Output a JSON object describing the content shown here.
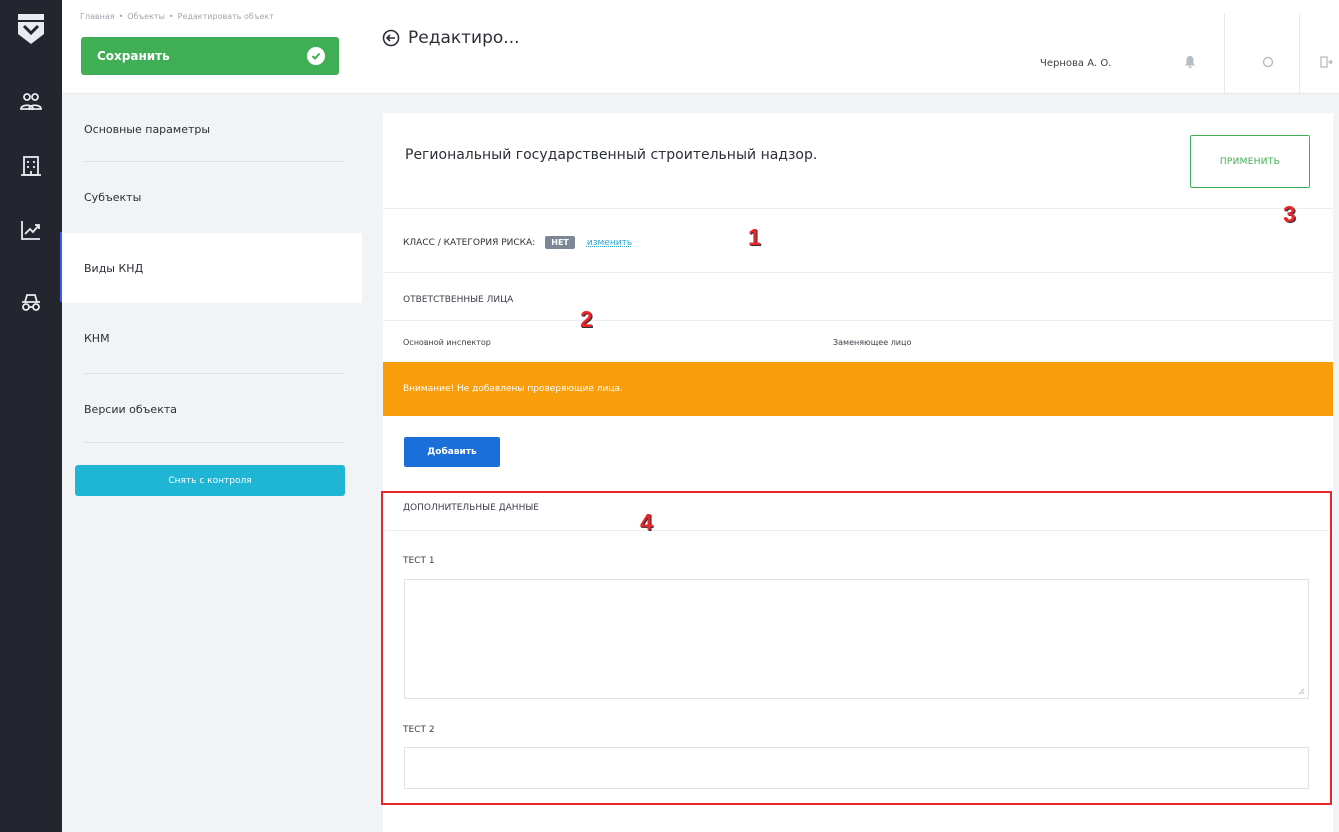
{
  "breadcrumb": {
    "items": [
      "Главная",
      "Объекты",
      "Редактировать объект"
    ]
  },
  "header": {
    "save_label": "Сохранить",
    "title": "Редактиро...",
    "user_name": "Чернова А. О."
  },
  "side_menu": {
    "items": [
      {
        "label": "Основные параметры"
      },
      {
        "label": "Субъекты"
      },
      {
        "label": "Виды КНД"
      },
      {
        "label": "КНМ"
      },
      {
        "label": "Версии объекта"
      }
    ],
    "active_item": "Виды КНД",
    "unmonitor_label": "Снять с контроля"
  },
  "card": {
    "title": "Региональный государственный строительный надзор.",
    "apply_label": "ПРИМЕНИТЬ",
    "risk_label": "КЛАСС / КАТЕГОРИЯ РИСКА:",
    "risk_value": "НЕТ",
    "risk_change": "изменить",
    "responsible_heading": "ОТВЕТСТВЕННЫЕ ЛИЦА",
    "col_main_inspector": "Основной инспектор",
    "col_substitute": "Заменяющее лицо",
    "alert_text": "Внимание! Не добавлены проверяющие лица.",
    "add_label": "Добавить",
    "extra_heading": "ДОПОЛНИТЕЛЬНЫЕ ДАННЫЕ",
    "field1_label": "ТЕСТ 1",
    "field1_value": "",
    "field2_label": "ТЕСТ 2",
    "field2_value": ""
  },
  "callouts": [
    "1",
    "2",
    "3",
    "4"
  ],
  "colors": {
    "rail": "#23262e",
    "save_green": "#3fae54",
    "alert_orange": "#f99d0b",
    "add_blue": "#1b6fd8",
    "unmonitor_cyan": "#1fb5d4",
    "highlight_red": "#e8262b"
  }
}
